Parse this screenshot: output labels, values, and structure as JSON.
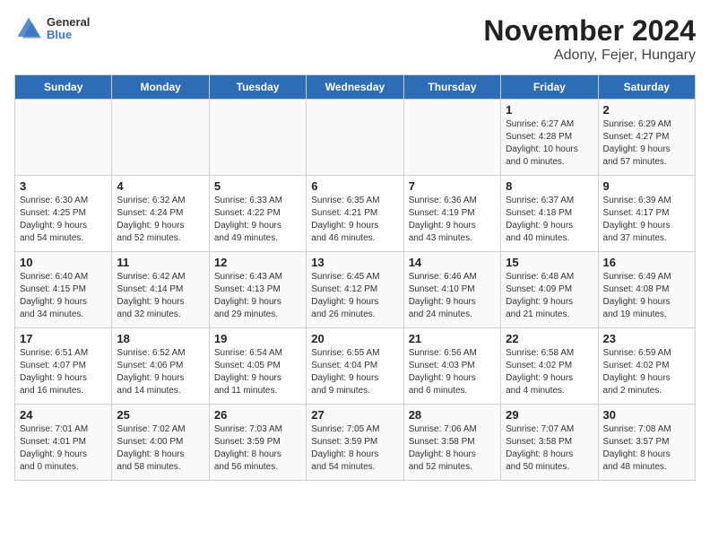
{
  "header": {
    "logo": {
      "line1": "General",
      "line2": "Blue"
    },
    "title": "November 2024",
    "subtitle": "Adony, Fejer, Hungary"
  },
  "days_of_week": [
    "Sunday",
    "Monday",
    "Tuesday",
    "Wednesday",
    "Thursday",
    "Friday",
    "Saturday"
  ],
  "weeks": [
    [
      {
        "day": "",
        "info": ""
      },
      {
        "day": "",
        "info": ""
      },
      {
        "day": "",
        "info": ""
      },
      {
        "day": "",
        "info": ""
      },
      {
        "day": "",
        "info": ""
      },
      {
        "day": "1",
        "info": "Sunrise: 6:27 AM\nSunset: 4:28 PM\nDaylight: 10 hours\nand 0 minutes."
      },
      {
        "day": "2",
        "info": "Sunrise: 6:29 AM\nSunset: 4:27 PM\nDaylight: 9 hours\nand 57 minutes."
      }
    ],
    [
      {
        "day": "3",
        "info": "Sunrise: 6:30 AM\nSunset: 4:25 PM\nDaylight: 9 hours\nand 54 minutes."
      },
      {
        "day": "4",
        "info": "Sunrise: 6:32 AM\nSunset: 4:24 PM\nDaylight: 9 hours\nand 52 minutes."
      },
      {
        "day": "5",
        "info": "Sunrise: 6:33 AM\nSunset: 4:22 PM\nDaylight: 9 hours\nand 49 minutes."
      },
      {
        "day": "6",
        "info": "Sunrise: 6:35 AM\nSunset: 4:21 PM\nDaylight: 9 hours\nand 46 minutes."
      },
      {
        "day": "7",
        "info": "Sunrise: 6:36 AM\nSunset: 4:19 PM\nDaylight: 9 hours\nand 43 minutes."
      },
      {
        "day": "8",
        "info": "Sunrise: 6:37 AM\nSunset: 4:18 PM\nDaylight: 9 hours\nand 40 minutes."
      },
      {
        "day": "9",
        "info": "Sunrise: 6:39 AM\nSunset: 4:17 PM\nDaylight: 9 hours\nand 37 minutes."
      }
    ],
    [
      {
        "day": "10",
        "info": "Sunrise: 6:40 AM\nSunset: 4:15 PM\nDaylight: 9 hours\nand 34 minutes."
      },
      {
        "day": "11",
        "info": "Sunrise: 6:42 AM\nSunset: 4:14 PM\nDaylight: 9 hours\nand 32 minutes."
      },
      {
        "day": "12",
        "info": "Sunrise: 6:43 AM\nSunset: 4:13 PM\nDaylight: 9 hours\nand 29 minutes."
      },
      {
        "day": "13",
        "info": "Sunrise: 6:45 AM\nSunset: 4:12 PM\nDaylight: 9 hours\nand 26 minutes."
      },
      {
        "day": "14",
        "info": "Sunrise: 6:46 AM\nSunset: 4:10 PM\nDaylight: 9 hours\nand 24 minutes."
      },
      {
        "day": "15",
        "info": "Sunrise: 6:48 AM\nSunset: 4:09 PM\nDaylight: 9 hours\nand 21 minutes."
      },
      {
        "day": "16",
        "info": "Sunrise: 6:49 AM\nSunset: 4:08 PM\nDaylight: 9 hours\nand 19 minutes."
      }
    ],
    [
      {
        "day": "17",
        "info": "Sunrise: 6:51 AM\nSunset: 4:07 PM\nDaylight: 9 hours\nand 16 minutes."
      },
      {
        "day": "18",
        "info": "Sunrise: 6:52 AM\nSunset: 4:06 PM\nDaylight: 9 hours\nand 14 minutes."
      },
      {
        "day": "19",
        "info": "Sunrise: 6:54 AM\nSunset: 4:05 PM\nDaylight: 9 hours\nand 11 minutes."
      },
      {
        "day": "20",
        "info": "Sunrise: 6:55 AM\nSunset: 4:04 PM\nDaylight: 9 hours\nand 9 minutes."
      },
      {
        "day": "21",
        "info": "Sunrise: 6:56 AM\nSunset: 4:03 PM\nDaylight: 9 hours\nand 6 minutes."
      },
      {
        "day": "22",
        "info": "Sunrise: 6:58 AM\nSunset: 4:02 PM\nDaylight: 9 hours\nand 4 minutes."
      },
      {
        "day": "23",
        "info": "Sunrise: 6:59 AM\nSunset: 4:02 PM\nDaylight: 9 hours\nand 2 minutes."
      }
    ],
    [
      {
        "day": "24",
        "info": "Sunrise: 7:01 AM\nSunset: 4:01 PM\nDaylight: 9 hours\nand 0 minutes."
      },
      {
        "day": "25",
        "info": "Sunrise: 7:02 AM\nSunset: 4:00 PM\nDaylight: 8 hours\nand 58 minutes."
      },
      {
        "day": "26",
        "info": "Sunrise: 7:03 AM\nSunset: 3:59 PM\nDaylight: 8 hours\nand 56 minutes."
      },
      {
        "day": "27",
        "info": "Sunrise: 7:05 AM\nSunset: 3:59 PM\nDaylight: 8 hours\nand 54 minutes."
      },
      {
        "day": "28",
        "info": "Sunrise: 7:06 AM\nSunset: 3:58 PM\nDaylight: 8 hours\nand 52 minutes."
      },
      {
        "day": "29",
        "info": "Sunrise: 7:07 AM\nSunset: 3:58 PM\nDaylight: 8 hours\nand 50 minutes."
      },
      {
        "day": "30",
        "info": "Sunrise: 7:08 AM\nSunset: 3:57 PM\nDaylight: 8 hours\nand 48 minutes."
      }
    ]
  ]
}
